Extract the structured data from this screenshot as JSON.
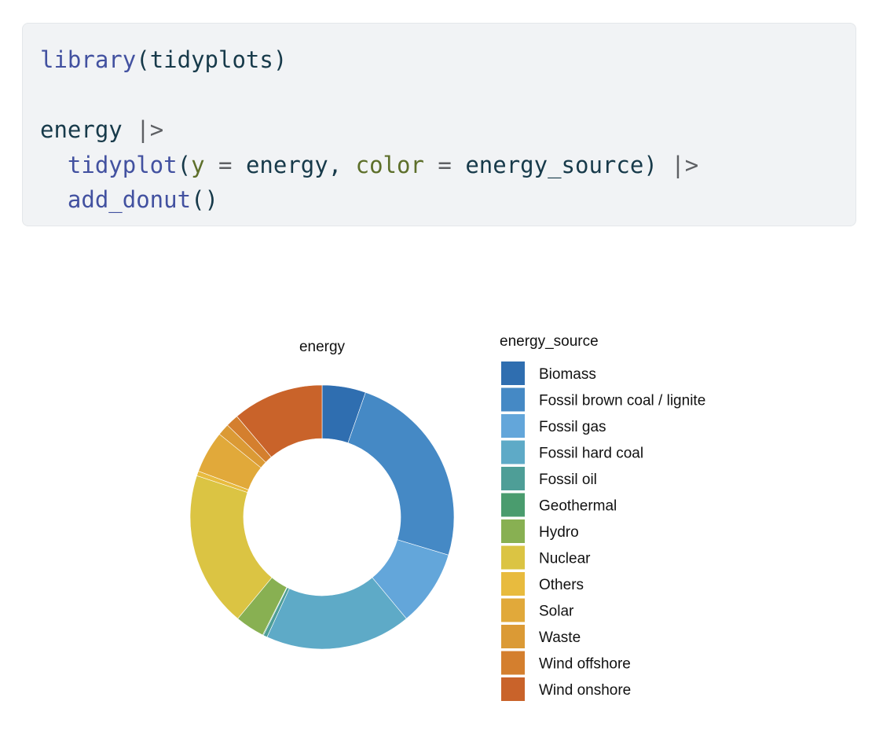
{
  "code": {
    "lines": [
      [
        {
          "t": "library",
          "c": "fn"
        },
        {
          "t": "(",
          "c": "id"
        },
        {
          "t": "tidyplots",
          "c": "id"
        },
        {
          "t": ")",
          "c": "id"
        }
      ],
      [],
      [
        {
          "t": "energy",
          "c": "id"
        },
        {
          "t": " ",
          "c": "id"
        },
        {
          "t": "|>",
          "c": "op"
        }
      ],
      [
        {
          "t": "  ",
          "c": "id"
        },
        {
          "t": "tidyplot",
          "c": "fn"
        },
        {
          "t": "(",
          "c": "id"
        },
        {
          "t": "y",
          "c": "arg"
        },
        {
          "t": " = ",
          "c": "op"
        },
        {
          "t": "energy",
          "c": "id"
        },
        {
          "t": ", ",
          "c": "id"
        },
        {
          "t": "color",
          "c": "arg"
        },
        {
          "t": " = ",
          "c": "op"
        },
        {
          "t": "energy_source",
          "c": "id"
        },
        {
          "t": ") ",
          "c": "id"
        },
        {
          "t": "|>",
          "c": "op"
        }
      ],
      [
        {
          "t": "  ",
          "c": "id"
        },
        {
          "t": "add_donut",
          "c": "fn"
        },
        {
          "t": "()",
          "c": "id"
        }
      ]
    ]
  },
  "chart_data": {
    "type": "pie",
    "variant": "donut",
    "title": "energy",
    "legend_title": "energy_source",
    "legend_position": "right",
    "categories": [
      "Biomass",
      "Fossil brown coal / lignite",
      "Fossil gas",
      "Fossil hard coal",
      "Fossil oil",
      "Geothermal",
      "Hydro",
      "Nuclear",
      "Others",
      "Solar",
      "Waste",
      "Wind offshore",
      "Wind onshore"
    ],
    "values": [
      5.5,
      25.0,
      9.6,
      18.4,
      0.5,
      0.1,
      3.7,
      19.6,
      0.6,
      5.3,
      1.5,
      1.6,
      11.5
    ],
    "colors": [
      "#2f6eb0",
      "#4589c5",
      "#63a6da",
      "#5eaac7",
      "#4e9e97",
      "#4a9c6e",
      "#88b052",
      "#dbc443",
      "#e8bb3e",
      "#e1a93a",
      "#db9a35",
      "#d47f2e",
      "#c9632a"
    ]
  }
}
